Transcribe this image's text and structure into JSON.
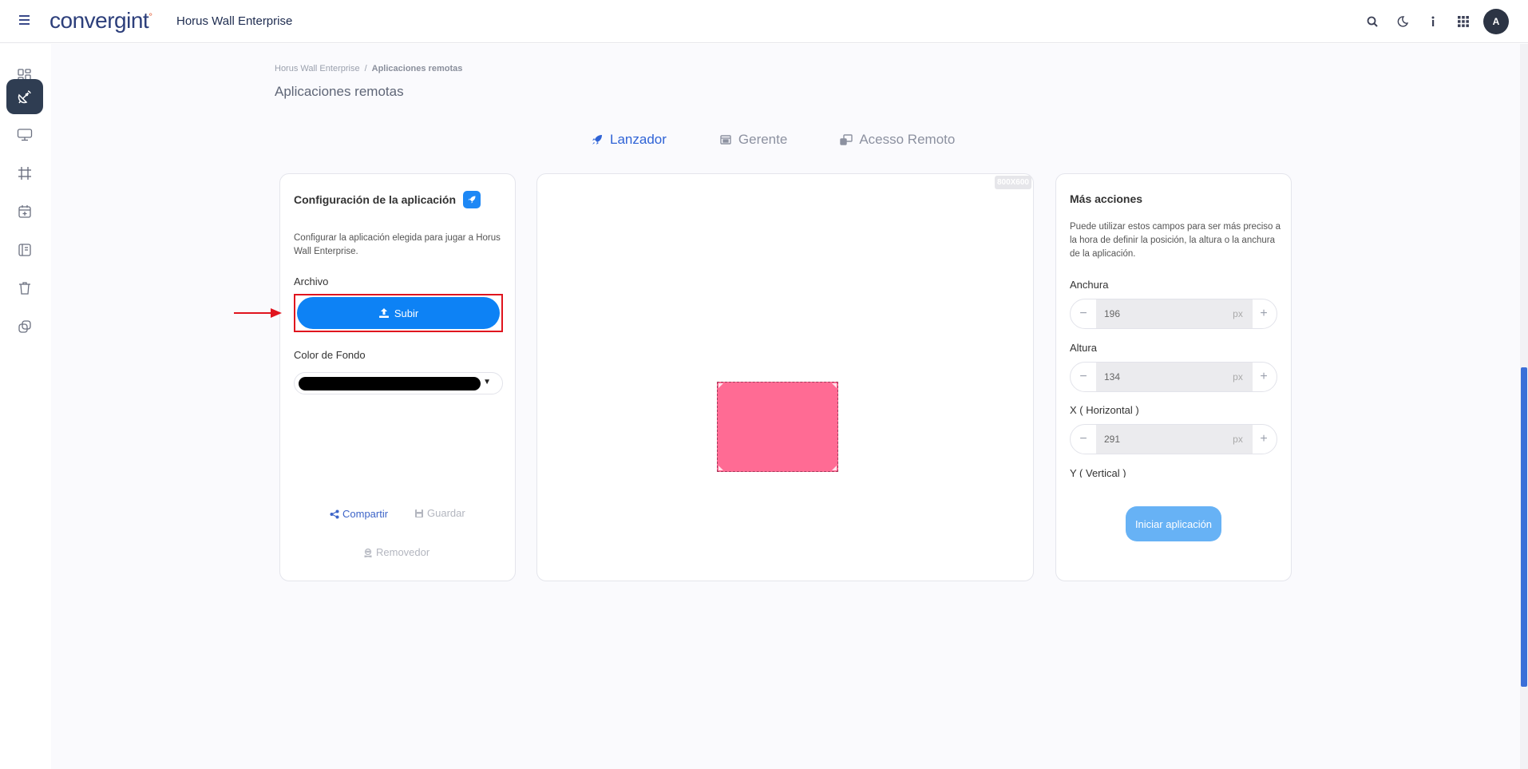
{
  "header": {
    "logo_text": "convergint",
    "app_title": "Horus Wall Enterprise",
    "avatar_initial": "A",
    "icons": [
      "search-icon",
      "moon-icon",
      "info-icon",
      "apps-grid-icon"
    ]
  },
  "sidebar": {
    "items": [
      {
        "name": "dashboard-icon",
        "active": false
      },
      {
        "name": "satellite-dish-icon",
        "active": true
      },
      {
        "name": "monitor-icon",
        "active": false
      },
      {
        "name": "crop-icon",
        "active": false
      },
      {
        "name": "calendar-plus-icon",
        "active": false
      },
      {
        "name": "notebook-icon",
        "active": false
      },
      {
        "name": "trash-icon",
        "active": false
      },
      {
        "name": "layers-icon",
        "active": false
      }
    ]
  },
  "breadcrumb": {
    "root": "Horus Wall Enterprise",
    "separator": "/",
    "current": "Aplicaciones remotas"
  },
  "page_title": "Aplicaciones remotas",
  "tabs": [
    {
      "label": "Lanzador",
      "icon": "rocket-icon",
      "active": true
    },
    {
      "label": "Gerente",
      "icon": "window-icon",
      "active": false
    },
    {
      "label": "Acesso Remoto",
      "icon": "remote-desktop-icon",
      "active": false
    }
  ],
  "config_card": {
    "title": "Configuración de la aplicación",
    "description": "Configurar la aplicación elegida para jugar a Horus Wall Enterprise.",
    "file_label": "Archivo",
    "upload_label": "Subir",
    "bg_color_label": "Color de Fondo",
    "bg_color_value": "#000000",
    "share_label": "Compartir",
    "save_label": "Guardar",
    "remove_label": "Removedor"
  },
  "canvas": {
    "resolution_badge": "800X600",
    "app_color": "#ff6b94"
  },
  "actions_card": {
    "title": "Más acciones",
    "description": "Puede utilizar estos campos para ser más preciso a la hora de definir la posición, la altura o la anchura de la aplicación.",
    "fields": [
      {
        "label": "Anchura",
        "value": "196",
        "unit": "px"
      },
      {
        "label": "Altura",
        "value": "134",
        "unit": "px"
      },
      {
        "label": "X ( Horizontal )",
        "value": "291",
        "unit": "px"
      },
      {
        "label": "Y ( Vertical )"
      }
    ],
    "start_label": "Iniciar aplicación"
  },
  "colors": {
    "primary": "#0d82f5",
    "active_sidebar": "#2f3d52",
    "tab_active": "#2f63d6",
    "annotation_red": "#e0141e"
  }
}
